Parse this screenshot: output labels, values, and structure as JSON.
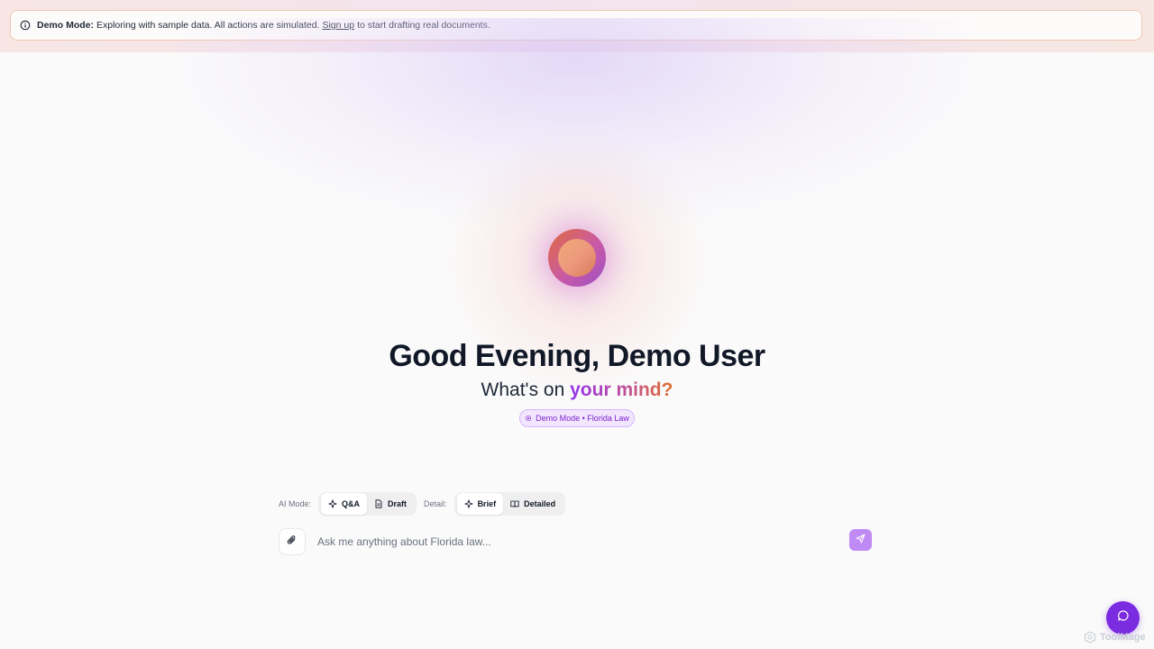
{
  "banner": {
    "label": "Demo Mode:",
    "text": "Exploring with sample data. All actions are simulated.",
    "link": "Sign up",
    "suffix": "to start drafting real documents."
  },
  "hero": {
    "greeting": "Good Evening, Demo User",
    "subtitle_prefix": "What's on",
    "subtitle_accent": "your mind?",
    "badge": "Demo Mode • Florida Law"
  },
  "controls": {
    "ai_mode_label": "AI Mode:",
    "ai_modes": [
      {
        "label": "Q&A",
        "icon": "sparkle-icon",
        "active": true
      },
      {
        "label": "Draft",
        "icon": "document-icon",
        "active": false
      }
    ],
    "detail_label": "Detail:",
    "detail_modes": [
      {
        "label": "Brief",
        "icon": "sparkle-icon",
        "active": true
      },
      {
        "label": "Detailed",
        "icon": "book-icon",
        "active": false
      }
    ]
  },
  "input": {
    "placeholder": "Ask me anything about Florida law...",
    "value": ""
  },
  "watermark": "ToolMage",
  "colors": {
    "accent": "#7c2ce0",
    "send_button": "#c08af5",
    "badge_bg": "#f1e6fd"
  }
}
